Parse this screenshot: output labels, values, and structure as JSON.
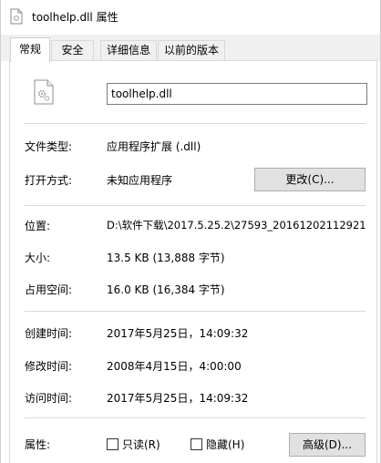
{
  "window": {
    "title": "toolhelp.dll 属性",
    "icon": "dll-file-icon"
  },
  "tabs": [
    {
      "label": "常规",
      "active": true
    },
    {
      "label": "安全",
      "active": false
    },
    {
      "label": "详细信息",
      "active": false
    },
    {
      "label": "以前的版本",
      "active": false
    }
  ],
  "general": {
    "file_icon": "dll-gear-icon",
    "file_name": "toolhelp.dll",
    "file_type_label": "文件类型:",
    "file_type_value": "应用程序扩展 (.dll)",
    "opens_with_label": "打开方式:",
    "opens_with_value": "未知应用程序",
    "change_button": "更改(C)...",
    "location_label": "位置:",
    "location_value": "D:\\软件下载\\2017.5.25.2\\27593_20161202112921",
    "size_label": "大小:",
    "size_value": "13.5 KB (13,888 字节)",
    "size_on_disk_label": "占用空间:",
    "size_on_disk_value": "16.0 KB (16,384 字节)",
    "created_label": "创建时间:",
    "created_value": "2017年5月25日，14:09:32",
    "modified_label": "修改时间:",
    "modified_value": "2008年4月15日，4:00:00",
    "accessed_label": "访问时间:",
    "accessed_value": "2017年5月25日，14:09:32",
    "attributes_label": "属性:",
    "readonly_label": "只读(R)",
    "readonly_checked": false,
    "hidden_label": "隐藏(H)",
    "hidden_checked": false,
    "advanced_button": "高级(D)..."
  }
}
